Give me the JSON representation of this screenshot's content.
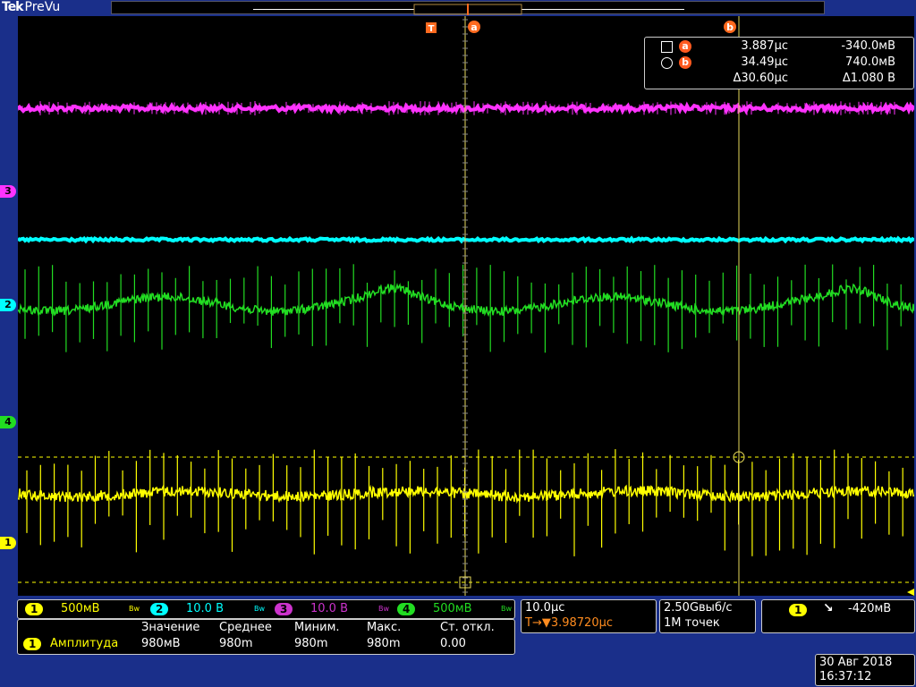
{
  "brand": {
    "tek": "Tek",
    "mode": "PreVu"
  },
  "cursor_readout": {
    "a_time": "3.887µс",
    "a_volt": "-340.0мВ",
    "b_time": "34.49µс",
    "b_volt": "740.0мВ",
    "delta_time": "Δ30.60µс",
    "delta_volt": "Δ1.080 В",
    "a_label": "a",
    "b_label": "b"
  },
  "markers": {
    "trigger": "T",
    "cursor_a": "a",
    "cursor_b": "b"
  },
  "channels": [
    {
      "num": "1",
      "scale": "500мВ",
      "color": "#ffff00"
    },
    {
      "num": "2",
      "scale": "10.0 В",
      "color": "#00ffff"
    },
    {
      "num": "3",
      "scale": "10.0 В",
      "color": "#ff33ff"
    },
    {
      "num": "4",
      "scale": "500мВ",
      "color": "#22dd22"
    }
  ],
  "bw_mark": "Bw",
  "measurement": {
    "headers": [
      "Значение",
      "Среднее",
      "Миним.",
      "Макс.",
      "Ст. откл."
    ],
    "channel": "1",
    "name": "Амплитуда",
    "values": [
      "980мВ",
      "980m",
      "980m",
      "980m",
      "0.00"
    ]
  },
  "timebase": {
    "scale": "10.0µс",
    "trigger_pos": "T→▼3.98720µс"
  },
  "acquisition": {
    "rate": "2.50Gвыб/с",
    "points": "1M точек"
  },
  "trigger": {
    "channel": "1",
    "slope": "↘",
    "level": "-420мВ"
  },
  "datetime": {
    "date": "30 Авг 2018",
    "time": "16:37:12"
  },
  "colors": {
    "ch1": "#ffff00",
    "ch2": "#00ffff",
    "ch3": "#ff33ff",
    "ch4": "#22dd22",
    "accent": "#ff6a1f",
    "panel_bg": "#1a2f8a"
  }
}
